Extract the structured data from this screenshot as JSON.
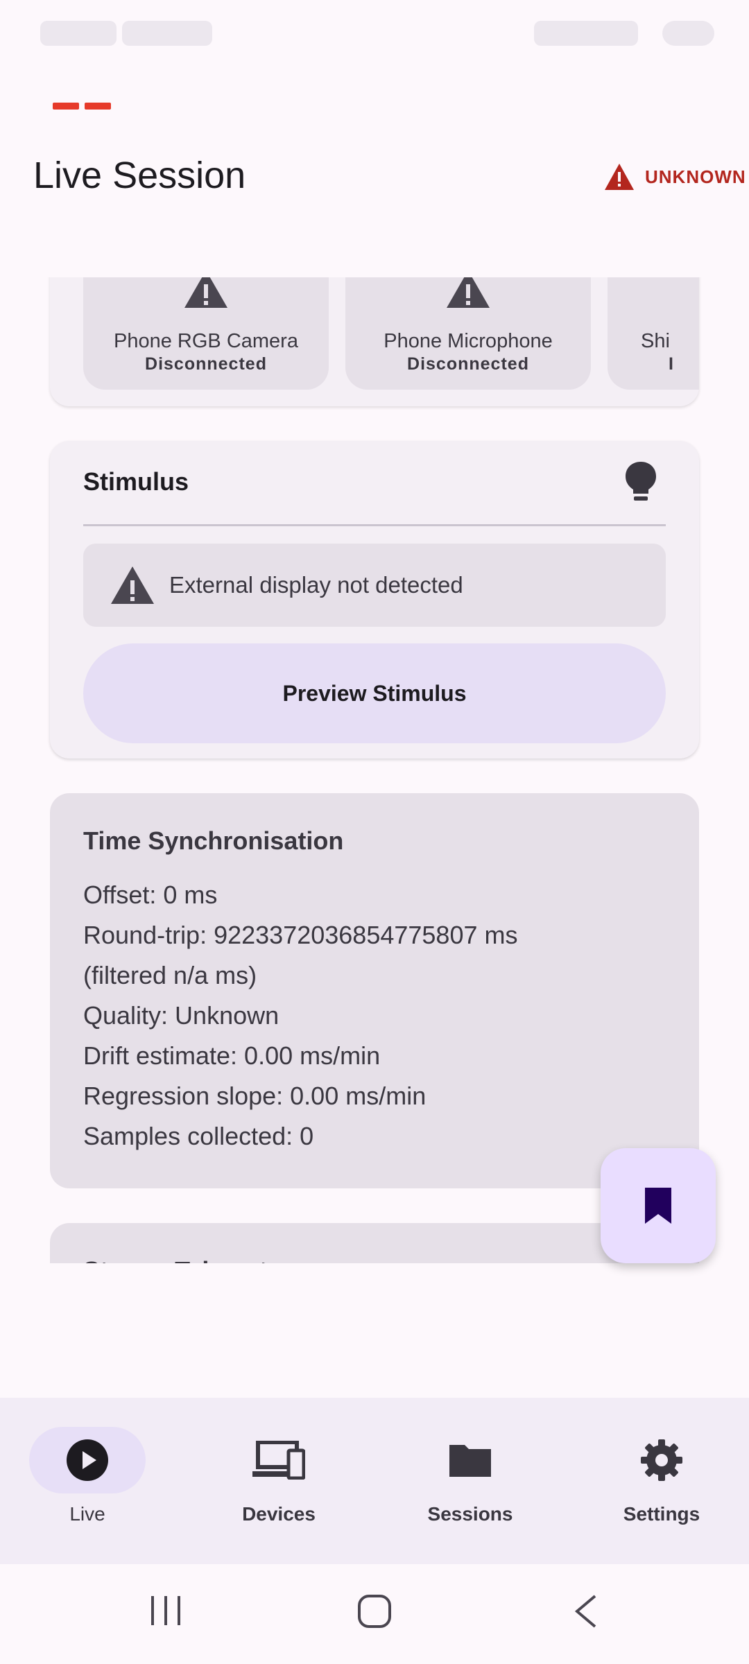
{
  "app": {
    "title": "Live Session"
  },
  "header": {
    "status_label": "UNKNOWN"
  },
  "sensors": [
    {
      "name": "Phone RGB Camera",
      "state": "Disconnected"
    },
    {
      "name": "Phone Microphone",
      "state": "Disconnected"
    },
    {
      "name": "Shi",
      "state": "I"
    }
  ],
  "stimulus": {
    "title": "Stimulus",
    "alert": "External display not detected",
    "preview_button": "Preview Stimulus"
  },
  "time_sync": {
    "title": "Time Synchronisation",
    "offset": "Offset: 0 ms",
    "round_trip": "Round-trip: 9223372036854775807 ms",
    "filtered": "(filtered n/a ms)",
    "quality": "Quality: Unknown",
    "drift": "Drift estimate: 0.00 ms/min",
    "slope": "Regression slope: 0.00 ms/min",
    "samples": "Samples collected: 0"
  },
  "next_card": {
    "title": "Stream Telemetry"
  },
  "nav": {
    "items": [
      {
        "label": "Live",
        "icon": "play-circle-icon",
        "active": true
      },
      {
        "label": "Devices",
        "icon": "devices-icon",
        "active": false
      },
      {
        "label": "Sessions",
        "icon": "folder-icon",
        "active": false
      },
      {
        "label": "Settings",
        "icon": "gear-icon",
        "active": false
      }
    ]
  },
  "colors": {
    "accent_red": "#b3261e",
    "recording": "#e63a2a",
    "fab_bg": "#e9ddff",
    "fab_icon": "#21005d"
  }
}
